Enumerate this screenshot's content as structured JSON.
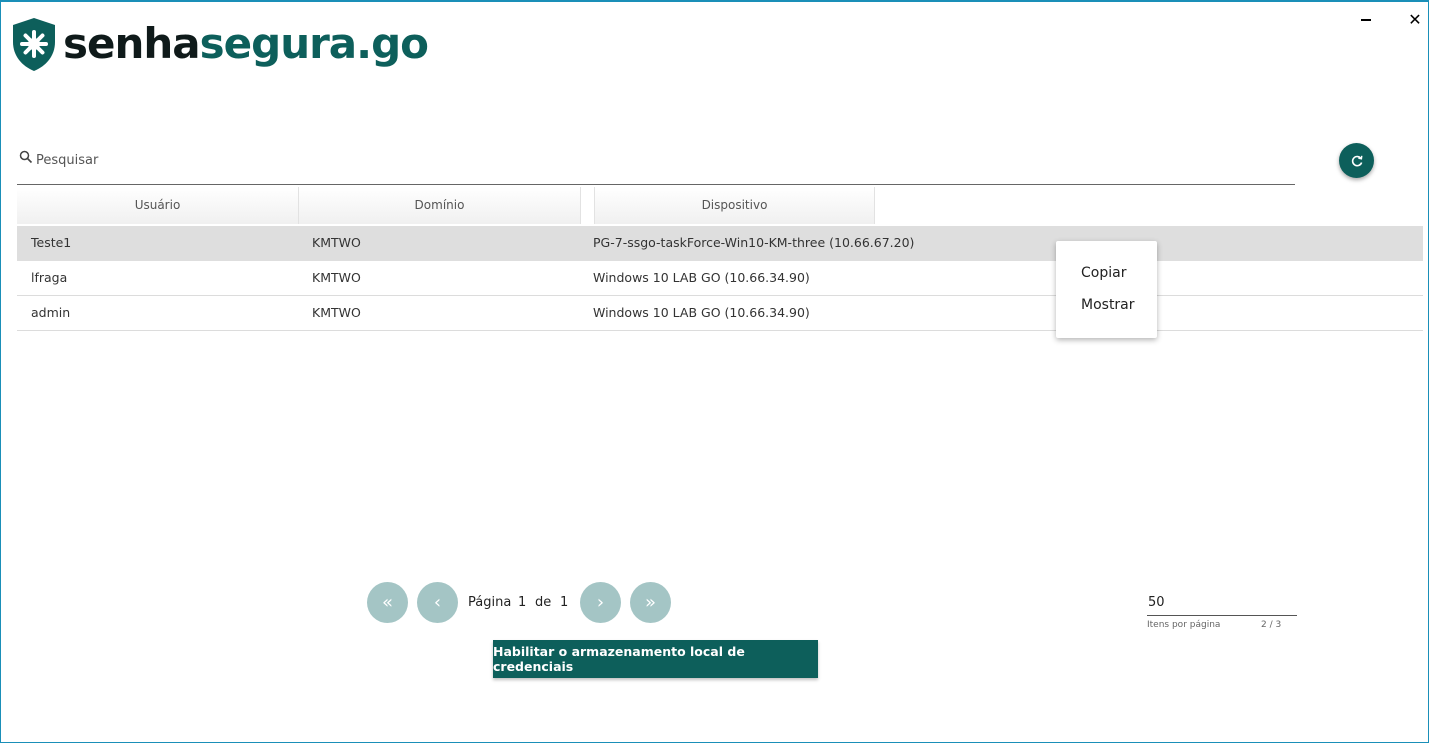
{
  "window": {
    "minimize_icon": "minimize-icon",
    "close_symbol": "✕"
  },
  "brand": {
    "name_part1": "senha",
    "name_part2": "segura.go",
    "colors": {
      "dark": "#0f1a1a",
      "teal": "#0d5f5b"
    }
  },
  "search": {
    "placeholder": "Pesquisar",
    "value": ""
  },
  "table": {
    "columns": [
      "Usuário",
      "Domínio",
      "Dispositivo"
    ],
    "rows": [
      {
        "user": "Teste1",
        "domain": "KMTWO",
        "device": "PG-7-ssgo-taskForce-Win10-KM-three (10.66.67.20)",
        "selected": true
      },
      {
        "user": "lfraga",
        "domain": "KMTWO",
        "device": "Windows 10 LAB GO (10.66.34.90)",
        "selected": false
      },
      {
        "user": "admin",
        "domain": "KMTWO",
        "device": "Windows 10 LAB GO (10.66.34.90)",
        "selected": false
      }
    ]
  },
  "context_menu": {
    "copy": "Copiar",
    "show": "Mostrar"
  },
  "pagination": {
    "label": "Página",
    "current": "1",
    "of": "de",
    "total": "1",
    "first_symbol": "«",
    "prev_symbol": "‹",
    "next_symbol": "›",
    "last_symbol": "»"
  },
  "per_page": {
    "value": "50",
    "label": "Itens por página",
    "count": "2 / 3"
  },
  "actions": {
    "enable_local_storage": "Habilitar o armazenamento local de credenciais"
  },
  "colors": {
    "accent": "#0d5f5b",
    "pagination_disabled": "#a4c5c5",
    "selected_row": "#dedede"
  }
}
